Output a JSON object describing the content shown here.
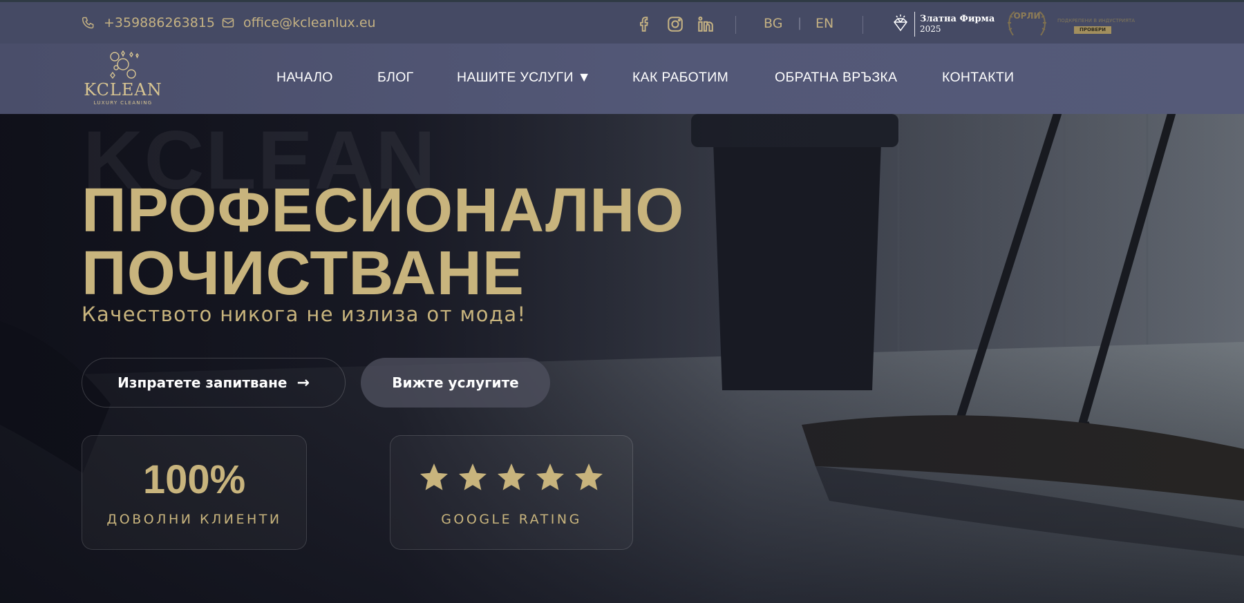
{
  "topbar": {
    "phone": "+359886263815",
    "email": "office@kcleanlux.eu",
    "languages": [
      "BG",
      "EN"
    ],
    "lang_separator": "|",
    "award_gold": {
      "line1": "Златна Фирма",
      "line2": "2025"
    },
    "award_orli": {
      "name": "ОРЛИ",
      "tagline": "ПОДКРЕПЕНИ В ИНДУСТРИЯТА",
      "button": "ПРОВЕРИ"
    }
  },
  "brand": {
    "name": "KCLEAN",
    "subtitle": "LUXURY CLEANING"
  },
  "nav": {
    "items": [
      "НАЧАЛО",
      "БЛОГ",
      "НАШИТЕ УСЛУГИ ▼",
      "КАК РАБОТИМ",
      "ОБРАТНА ВРЪЗКА",
      "КОНТАКТИ"
    ]
  },
  "hero": {
    "watermark": "KCLEAN",
    "headline_line1": "ПРОФЕСИОНАЛНО",
    "headline_line2": "ПОЧИСТВАНЕ",
    "tagline": "Качеството никога не излиза от мода!",
    "cta_primary": "Изпратете запитване",
    "cta_primary_arrow": "→",
    "cta_secondary": "Вижте услугите"
  },
  "stats": {
    "clients_value": "100%",
    "clients_label": "ДОВОЛНИ КЛИЕНТИ",
    "rating_stars": 5,
    "rating_label": "GOOGLE RATING"
  },
  "colors": {
    "gold": "#c8b47d",
    "topbar_bg": "#454a64",
    "navbar_bg": "#535877",
    "hero_dark": "#15161f"
  },
  "icons": [
    "phone-icon",
    "mail-icon",
    "facebook-icon",
    "instagram-icon",
    "linkedin-icon",
    "diamond-icon",
    "star-icon",
    "arrow-right-icon"
  ]
}
